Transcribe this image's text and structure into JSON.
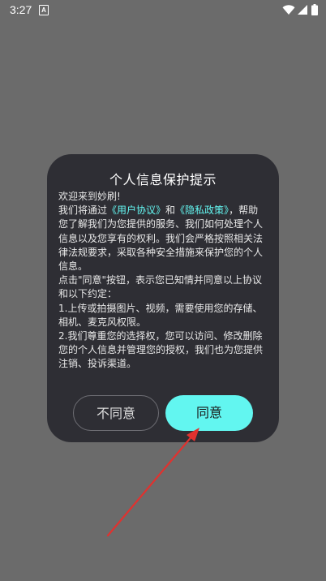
{
  "status_bar": {
    "time": "3:27",
    "notification_letter": "A"
  },
  "dialog": {
    "title": "个人信息保护提示",
    "welcome": "欢迎来到妙刷!",
    "p1_pre": "我们将通过",
    "link_user_agreement": "《用户协议》",
    "p1_and": "和",
    "link_privacy_policy": "《隐私政策》",
    "p1_post": "，帮助您了解我们为您提供的服务、我们如何处理个人信息以及您享有的权利。我们会严格按照相关法律法规要求，采取各种安全措施来保护您的个人信息。",
    "p2": "点击\"同意\"按钮，表示您已知情并同意以上协议和以下约定：",
    "p3": "1.上传或拍摄图片、视频，需要使用您的存储、相机、麦克风权限。",
    "p4": "2.我们尊重您的选择权，您可以访问、修改删除您的个人信息并管理您的授权，我们也为您提供注销、投诉渠道。",
    "disagree_label": "不同意",
    "agree_label": "同意"
  },
  "colors": {
    "background": "#6b6b6b",
    "dialog": "#2e2e34",
    "accent": "#62f6f0",
    "arrow": "#e0322f"
  }
}
